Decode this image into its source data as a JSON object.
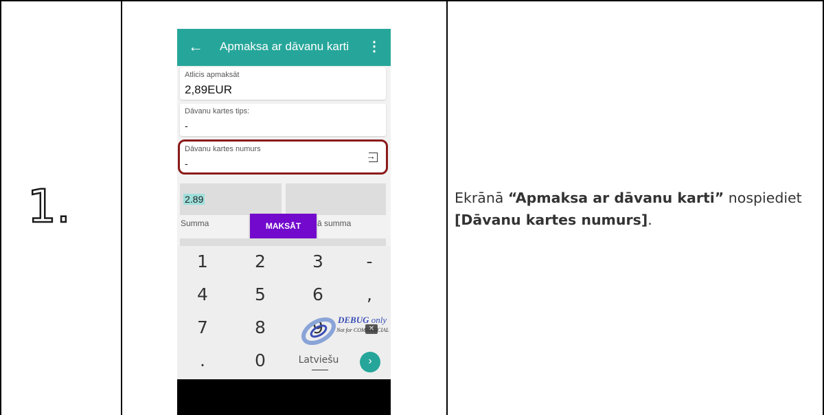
{
  "step": "1.",
  "phone": {
    "title": "Apmaksa ar dāvanu karti",
    "cards": [
      {
        "label": "Atlicis apmaksāt",
        "value": "2,89EUR"
      },
      {
        "label": "Dāvanu kartes tips:",
        "value": "-"
      },
      {
        "label": "Dāvanu kartes numurs",
        "value": "-"
      }
    ],
    "amount_value": "2.89",
    "amount_label": "Summa",
    "second_label_fragment": "ā summa",
    "pay_button": "MAKSĀT",
    "keys": [
      "1",
      "2",
      "3",
      "-",
      "4",
      "5",
      "6",
      ",",
      "7",
      "8",
      "9",
      ".",
      "0"
    ],
    "language": "Latviešu",
    "watermark": {
      "debug": "DEBUG",
      "only": "only",
      "note": "Not for COMMERCIAL"
    }
  },
  "instruction": {
    "prefix": "Ekrānā",
    "screen_name": "“Apmaksa ar dāvanu karti”",
    "middle": "nospiediet",
    "target": "[Dāvanu kartes numurs]",
    "suffix": "."
  },
  "colors": {
    "appbar": "#26a69a",
    "pay_button": "#7209cc",
    "highlight": "#8b1a1a"
  }
}
